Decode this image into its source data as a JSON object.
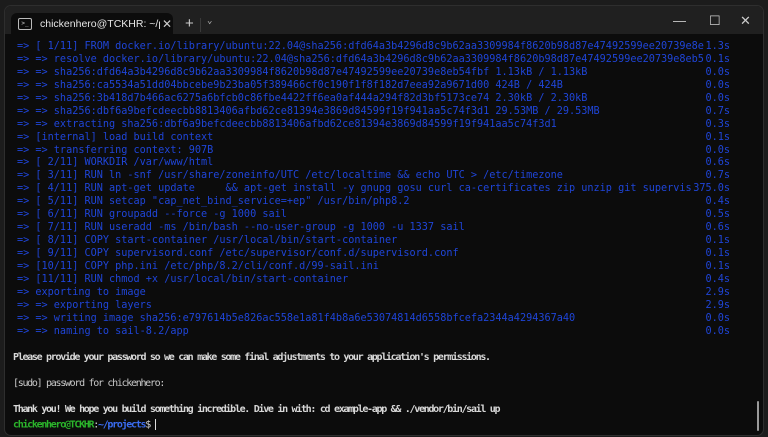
{
  "window": {
    "tab_title": "chickenhero@TCKHR: ~/proje",
    "tab_icon": "terminal-icon",
    "new_tab": "+",
    "dropdown": "⌄",
    "minimize": "—",
    "maximize": "☐",
    "close": "✕",
    "tab_close": "✕"
  },
  "build_lines": [
    {
      "text": "=> [ 1/11] FROM docker.io/library/ubuntu:22.04@sha256:dfd64a3b4296d8c9b62aa3309984f8620b98d87e47492599ee20739e8e",
      "time": "1.3s"
    },
    {
      "text": "=> => resolve docker.io/library/ubuntu:22.04@sha256:dfd64a3b4296d8c9b62aa3309984f8620b98d87e47492599ee20739e8eb5",
      "time": "0.1s"
    },
    {
      "text": "=> => sha256:dfd64a3b4296d8c9b62aa3309984f8620b98d87e47492599ee20739e8eb54fbf 1.13kB / 1.13kB",
      "time": "0.0s"
    },
    {
      "text": "=> => sha256:ca5534a51dd04bbcebe9b23ba05f389466cf0c190f1f8f182d7eea92a9671d00 424B / 424B",
      "time": "0.0s"
    },
    {
      "text": "=> => sha256:3b418d7b466ac6275a6bfcb0c86fbe4422ff6ea0af444a294f82d3bf5173ce74 2.30kB / 2.30kB",
      "time": "0.0s"
    },
    {
      "text": "=> => sha256:dbf6a9befcdeecbb8813406afbd62ce81394e3869d84599f19f941aa5c74f3d1 29.53MB / 29.53MB",
      "time": "0.7s"
    },
    {
      "text": "=> => extracting sha256:dbf6a9befcdeecbb8813406afbd62ce81394e3869d84599f19f941aa5c74f3d1",
      "time": "0.3s"
    },
    {
      "text": "=> [internal] load build context",
      "time": "0.1s"
    },
    {
      "text": "=> => transferring context: 907B",
      "time": "0.0s"
    },
    {
      "text": "=> [ 2/11] WORKDIR /var/www/html",
      "time": "0.6s"
    },
    {
      "text": "=> [ 3/11] RUN ln -snf /usr/share/zoneinfo/UTC /etc/localtime && echo UTC > /etc/timezone",
      "time": "0.7s"
    },
    {
      "text": "=> [ 4/11] RUN apt-get update     && apt-get install -y gnupg gosu curl ca-certificates zip unzip git supervis",
      "time": "375.0s"
    },
    {
      "text": "=> [ 5/11] RUN setcap \"cap_net_bind_service=+ep\" /usr/bin/php8.2",
      "time": "0.4s"
    },
    {
      "text": "=> [ 6/11] RUN groupadd --force -g 1000 sail",
      "time": "0.5s"
    },
    {
      "text": "=> [ 7/11] RUN useradd -ms /bin/bash --no-user-group -g 1000 -u 1337 sail",
      "time": "0.6s"
    },
    {
      "text": "=> [ 8/11] COPY start-container /usr/local/bin/start-container",
      "time": "0.1s"
    },
    {
      "text": "=> [ 9/11] COPY supervisord.conf /etc/supervisor/conf.d/supervisord.conf",
      "time": "0.1s"
    },
    {
      "text": "=> [10/11] COPY php.ini /etc/php/8.2/cli/conf.d/99-sail.ini",
      "time": "0.1s"
    },
    {
      "text": "=> [11/11] RUN chmod +x /usr/local/bin/start-container",
      "time": "0.4s"
    },
    {
      "text": "=> exporting to image",
      "time": "2.9s"
    },
    {
      "text": "=> => exporting layers",
      "time": "2.9s"
    },
    {
      "text": "=> => writing image sha256:e797614b5e826ac558e1a81f4b8a6e53074814d6558bfcefa2344a4294367a40",
      "time": "0.0s"
    },
    {
      "text": "=> => naming to sail-8.2/app",
      "time": "0.0s"
    }
  ],
  "messages": {
    "password_prompt": "Please provide your password so we can make some final adjustments to your application's permissions.",
    "sudo": "[sudo] password for chickenhero:",
    "thank_you": "Thank you! We hope you build something incredible. Dive in with: cd example-app && ./vendor/bin/sail up"
  },
  "prompt": {
    "user_host": "chickenhero@TCKHR",
    "colon": ":",
    "path": "~/projects",
    "symbol": "$"
  }
}
